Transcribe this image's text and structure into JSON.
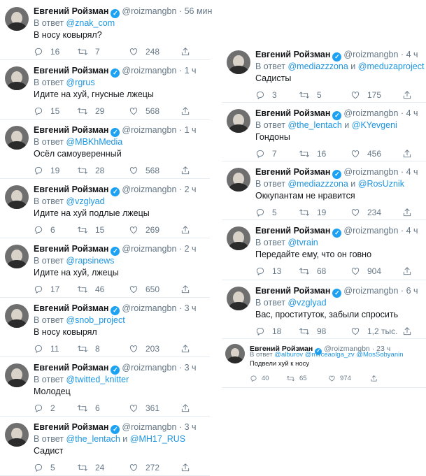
{
  "author": {
    "name": "Евгений Ройзман",
    "handle": "@roizmangbn",
    "dot": "·"
  },
  "reply_prefix": "В ответ",
  "reply_and": "и",
  "icons": [
    "reply-icon",
    "retweet-icon",
    "like-icon",
    "share-icon",
    "verified-badge-icon",
    "avatar"
  ],
  "colors": {
    "link": "#1b95e0",
    "muted": "#657786",
    "verified": "#1da1f2"
  },
  "left_tweets": [
    {
      "time": "56 мин",
      "mentions": [
        "@znak_com"
      ],
      "text": "В носу ковырял?",
      "replies": "16",
      "retweets": "7",
      "likes": "248"
    },
    {
      "time": "1 ч",
      "mentions": [
        "@rgrus"
      ],
      "text": "Идите на хуй, гнусные лжецы",
      "replies": "15",
      "retweets": "29",
      "likes": "568"
    },
    {
      "time": "1 ч",
      "mentions": [
        "@MBKhMedia"
      ],
      "text": "Осёл самоуверенный",
      "replies": "19",
      "retweets": "28",
      "likes": "568"
    },
    {
      "time": "2 ч",
      "mentions": [
        "@vzglyad"
      ],
      "text": "Идите на хуй подлые лжецы",
      "replies": "6",
      "retweets": "15",
      "likes": "269"
    },
    {
      "time": "2 ч",
      "mentions": [
        "@rapsinews"
      ],
      "text": "Идите на хуй, лжецы",
      "replies": "17",
      "retweets": "46",
      "likes": "650"
    },
    {
      "time": "3 ч",
      "mentions": [
        "@snob_project"
      ],
      "text": "В носу ковырял",
      "replies": "11",
      "retweets": "8",
      "likes": "203"
    },
    {
      "time": "3 ч",
      "mentions": [
        "@twitted_knitter"
      ],
      "text": "Молодец",
      "replies": "2",
      "retweets": "6",
      "likes": "361"
    },
    {
      "time": "3 ч",
      "mentions": [
        "@the_lentach",
        "@MH17_RUS"
      ],
      "text": "Садист",
      "replies": "5",
      "retweets": "24",
      "likes": "272"
    }
  ],
  "right_tweets": [
    {
      "time": "4 ч",
      "mentions": [
        "@mediazzzona",
        "@meduzaproject"
      ],
      "text": "Садисты",
      "replies": "3",
      "retweets": "5",
      "likes": "175"
    },
    {
      "time": "4 ч",
      "mentions": [
        "@the_lentach",
        "@KYevgeni"
      ],
      "text": "Гондоны",
      "replies": "7",
      "retweets": "16",
      "likes": "456"
    },
    {
      "time": "4 ч",
      "mentions": [
        "@mediazzzona",
        "@RosUznik"
      ],
      "text": "Оккупантам не нравится",
      "replies": "5",
      "retweets": "19",
      "likes": "234"
    },
    {
      "time": "4 ч",
      "mentions": [
        "@tvrain"
      ],
      "text": "Передайте ему, что он говно",
      "replies": "13",
      "retweets": "68",
      "likes": "904"
    },
    {
      "time": "6 ч",
      "mentions": [
        "@vzglyad"
      ],
      "text": "Вас, проституток, забыли спросить",
      "replies": "18",
      "retweets": "98",
      "likes": "1,2 тыс."
    },
    {
      "time": "23 ч",
      "mentions": [
        "@alburov",
        "@mirceaolga_zv",
        "@MosSobyanin"
      ],
      "mention_sep": " ",
      "text": "Подвели хуй к носу",
      "replies": "40",
      "retweets": "65",
      "likes": "974",
      "small": true
    }
  ]
}
